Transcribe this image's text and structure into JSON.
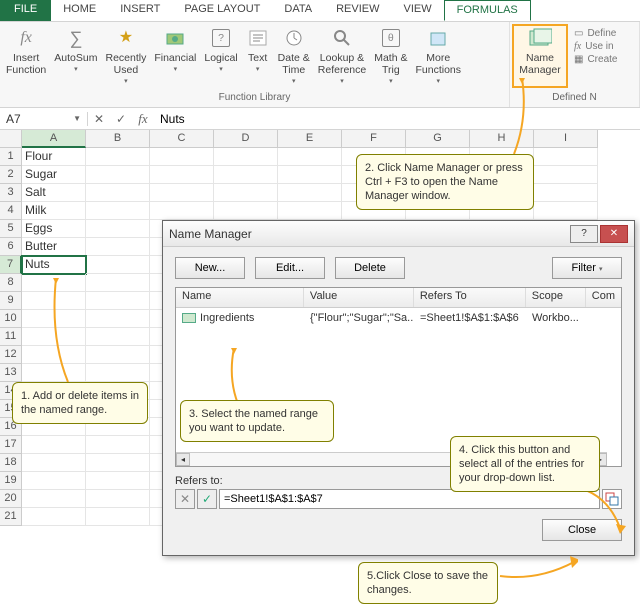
{
  "tabs": {
    "file": "FILE",
    "home": "HOME",
    "insert": "INSERT",
    "page_layout": "PAGE LAYOUT",
    "data": "DATA",
    "review": "REVIEW",
    "view": "VIEW",
    "formulas": "FORMULAS"
  },
  "ribbon": {
    "insert_function": "Insert\nFunction",
    "autosum": "AutoSum",
    "recently_used": "Recently\nUsed",
    "financial": "Financial",
    "logical": "Logical",
    "text": "Text",
    "date_time": "Date &\nTime",
    "lookup_ref": "Lookup &\nReference",
    "math_trig": "Math &\nTrig",
    "more_functions": "More\nFunctions",
    "name_manager": "Name\nManager",
    "group_function_library": "Function Library",
    "group_defined_names": "Defined N",
    "side_define": "Define",
    "side_use_in": "Use in",
    "side_create": "Create"
  },
  "formula_bar": {
    "name_box": "A7",
    "value": "Nuts"
  },
  "columns": [
    "A",
    "B",
    "C",
    "D",
    "E",
    "F",
    "G",
    "H",
    "I"
  ],
  "cells": [
    "Flour",
    "Sugar",
    "Salt",
    "Milk",
    "Eggs",
    "Butter",
    "Nuts"
  ],
  "row_count": 21,
  "callouts": {
    "c1": "1. Add or delete items in the named range.",
    "c2": "2. Click Name Manager or press Ctrl + F3 to open the Name Manager window.",
    "c3": "3. Select the named range you want to update.",
    "c4": "4. Click this button and select all of the entries for your drop-down list.",
    "c5": "5.Click Close to save the changes."
  },
  "dialog": {
    "title": "Name Manager",
    "new": "New...",
    "edit": "Edit...",
    "delete": "Delete",
    "filter": "Filter",
    "headers": {
      "name": "Name",
      "value": "Value",
      "refers_to": "Refers To",
      "scope": "Scope",
      "comment": "Com"
    },
    "row": {
      "name": "Ingredients",
      "value": "{\"Flour\";\"Sugar\";\"Sa...",
      "refers_to": "=Sheet1!$A$1:$A$6",
      "scope": "Workbo..."
    },
    "refers_label": "Refers to:",
    "refers_value": "=Sheet1!$A$1:$A$7",
    "close": "Close"
  }
}
